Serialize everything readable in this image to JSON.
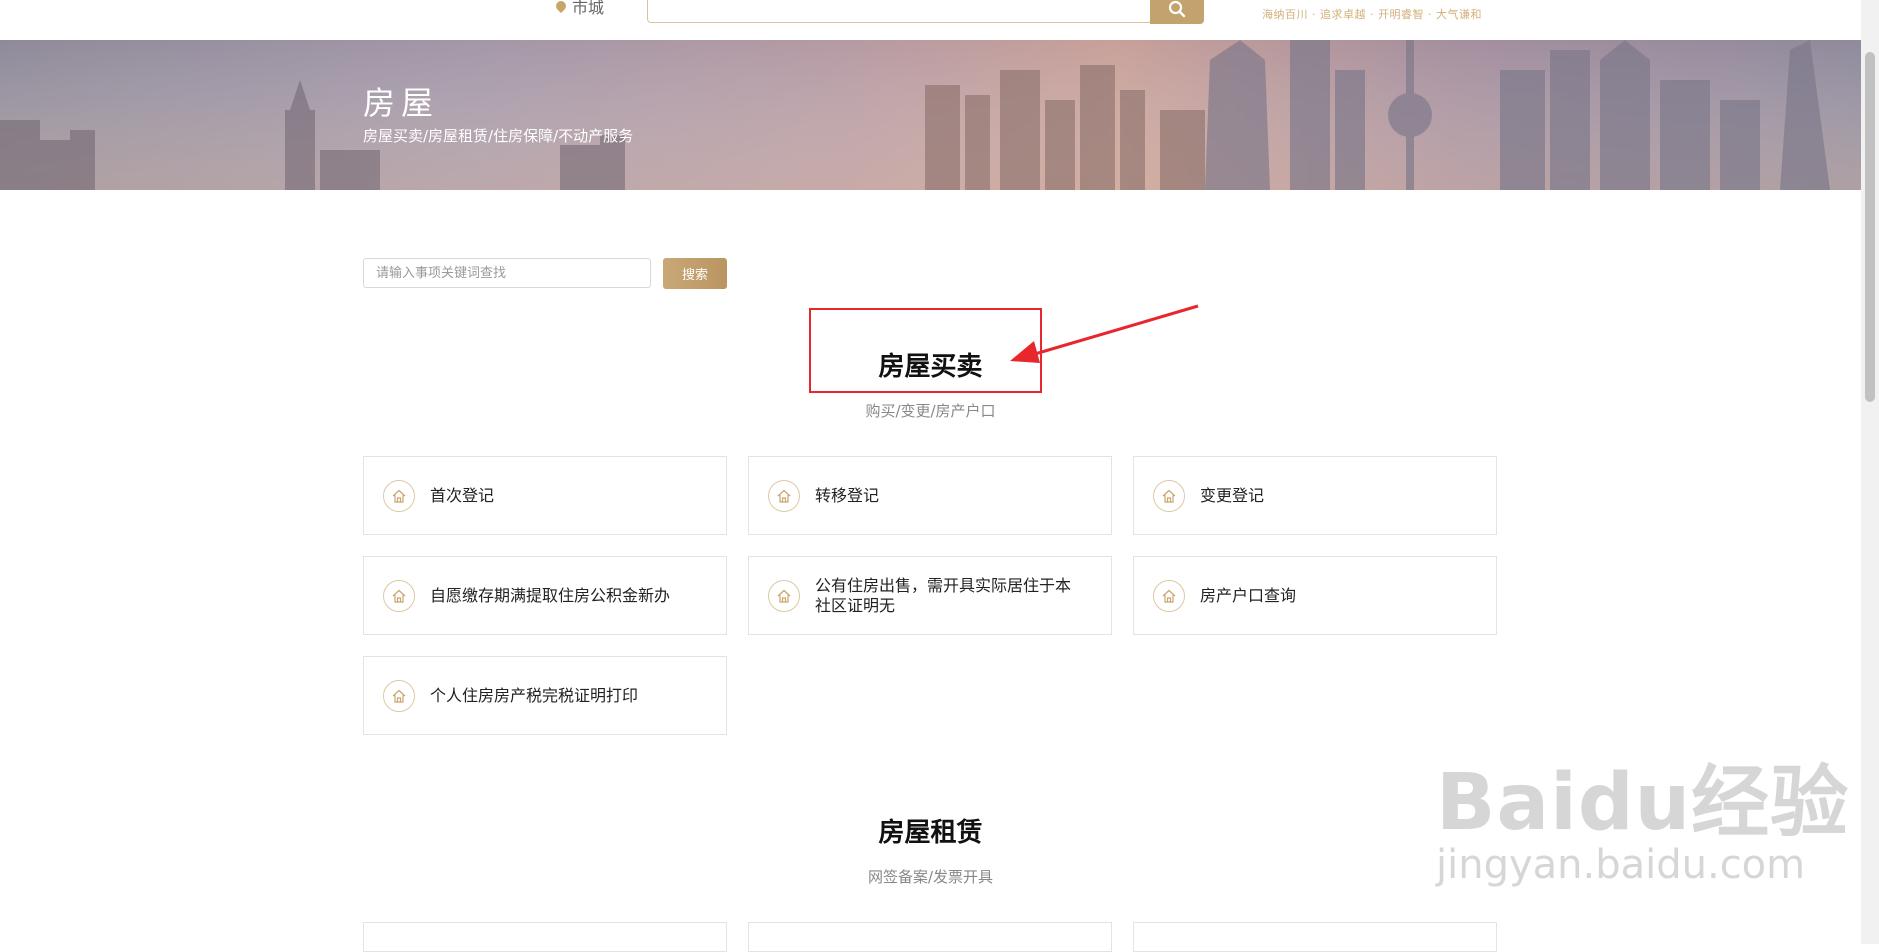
{
  "header": {
    "location": "市城",
    "slogan": "海纳百川 · 追求卓越 · 开明睿智 · 大气谦和"
  },
  "banner": {
    "title": "房屋",
    "subtitle": "房屋买卖/房屋租赁/住房保障/不动产服务"
  },
  "search": {
    "placeholder": "请输入事项关键词查找",
    "button_label": "搜索"
  },
  "sections": [
    {
      "title": "房屋买卖",
      "subtitle": "购买/变更/房产户口",
      "items": [
        {
          "label": "首次登记"
        },
        {
          "label": "转移登记"
        },
        {
          "label": "变更登记"
        },
        {
          "label": "自愿缴存期满提取住房公积金新办"
        },
        {
          "label": "公有住房出售，需开具实际居住于本社区证明无"
        },
        {
          "label": "房产户口查询"
        },
        {
          "label": "个人住房房产税完税证明打印"
        }
      ]
    },
    {
      "title": "房屋租赁",
      "subtitle": "网签备案/发票开具"
    }
  ],
  "watermark": {
    "brand": "Baidu经验",
    "url": "jingyan.baidu.com"
  },
  "colors": {
    "accent": "#c4a26e",
    "annotation_red": "#e8272d"
  }
}
